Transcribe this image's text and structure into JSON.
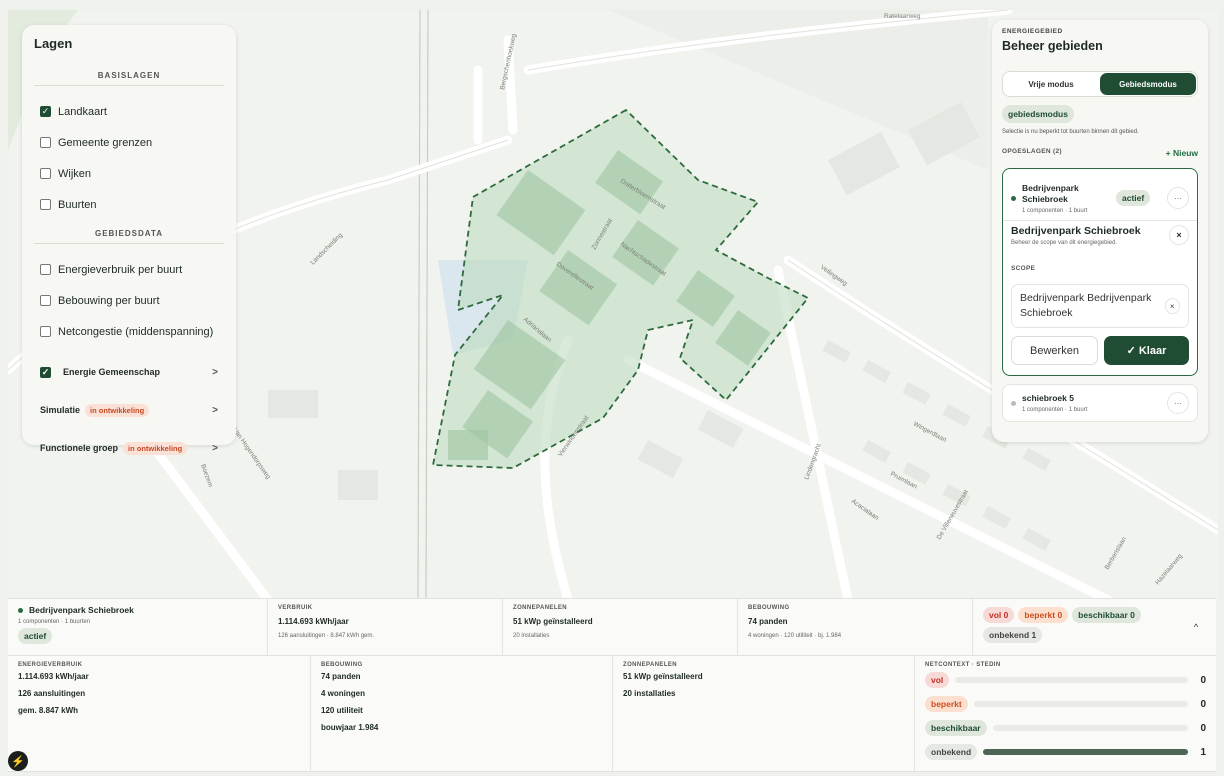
{
  "map": {
    "street_labels": [
      "Ratelaarweg",
      "Bergschenhoekweg",
      "Landscheiding",
      "Dotterbloemstraat",
      "Zonnestraat",
      "Nachtschadestraat",
      "Doverellestraat",
      "Adrianalaan",
      "Veilingweg",
      "Vierwindenstraat",
      "Wingerdlaan",
      "Pruimlaan",
      "Acacialaan",
      "De Villeneuvestraat",
      "Lindengracht",
      "Berberislaan",
      "Hazelaarweg",
      "Van Hogendorpsweg",
      "Boezem"
    ]
  },
  "layers": {
    "title": "Lagen",
    "basis_heading": "BASISLAGEN",
    "basis": [
      {
        "label": "Landkaart",
        "checked": true
      },
      {
        "label": "Gemeente grenzen",
        "checked": false
      },
      {
        "label": "Wijken",
        "checked": false
      },
      {
        "label": "Buurten",
        "checked": false
      }
    ],
    "gebied_heading": "GEBIEDSDATA",
    "gebied": [
      {
        "label": "Energieverbruik per buurt",
        "checked": false
      },
      {
        "label": "Bebouwing per buurt",
        "checked": false
      },
      {
        "label": "Netcongestie (middenspanning)",
        "checked": false
      }
    ],
    "features": [
      {
        "label": "Energie Gemeenschap",
        "checked": true,
        "tag": ""
      },
      {
        "label": "Simulatie",
        "tag": "in ontwikkeling"
      },
      {
        "label": "Functionele groep",
        "tag": "in ontwikkeling"
      }
    ],
    "chevron": ">"
  },
  "energy": {
    "eyebrow": "ENERGIEGEBIED",
    "title": "Beheer gebieden",
    "mode_free": "Vrije modus",
    "mode_area": "Gebiedsmodus",
    "mode_pill": "gebiedsmodus",
    "hint": "Selectie is nu beperkt tot buurten binnen dit gebied.",
    "saved_label": "OPGESLAGEN (2)",
    "new_label": "+ Nieuw",
    "areas": [
      {
        "name": "Bedrijvenpark Schiebroek",
        "meta": "1 componenten · 1 buurt",
        "badge": "actief"
      },
      {
        "name": "schiebroek 5",
        "meta": "1 componenten · 1 buurt"
      }
    ],
    "detail_title": "Bedrijvenpark Schiebroek",
    "detail_sub": "Beheer de scope van dit energiegebied.",
    "scope_label": "SCOPE",
    "scope_value": "Bedrijvenpark Bedrijvenpark Schiebroek",
    "edit_label": "Bewerken",
    "done_label": "✓ Klaar",
    "more": "···",
    "close": "×"
  },
  "summary": {
    "name": "Bedrijvenpark Schiebroek",
    "meta": "1 componenten · 1 buurten",
    "badge": "actief",
    "verbruik_label": "VERBRUIK",
    "verbruik_value": "1.114.693 kWh/jaar",
    "verbruik_sub": "126 aansluitingen · 8.847 kWh gem.",
    "zonne_label": "ZONNEPANELEN",
    "zonne_value": "51 kWp geïnstalleerd",
    "zonne_sub": "20 installaties",
    "bebouwing_label": "BEBOUWING",
    "bebouwing_value": "74 panden",
    "bebouwing_sub": "4 woningen · 120 utiliteit · bj. 1.984",
    "status": {
      "vol": "vol 0",
      "beperkt": "beperkt 0",
      "beschikbaar": "beschikbaar 0",
      "onbekend": "onbekend 1"
    },
    "collapse": "^"
  },
  "details": {
    "energie_label": "ENERGIEVERBRUIK",
    "energie_lines": [
      "1.114.693 kWh/jaar",
      "126 aansluitingen",
      "gem. 8.847 kWh"
    ],
    "bebouwing_label": "BEBOUWING",
    "bebouwing_lines": [
      "74 panden",
      "4 woningen",
      "120 utiliteit",
      "bouwjaar 1.984"
    ],
    "zonne_label": "ZONNEPANELEN",
    "zonne_lines": [
      "51 kWp geïnstalleerd",
      "20 installaties"
    ],
    "net_label": "NETCONTEXT · STEDIN",
    "net_rows": [
      {
        "label": "vol",
        "value": "0",
        "fraction": 0
      },
      {
        "label": "beperkt",
        "value": "0",
        "fraction": 0
      },
      {
        "label": "beschikbaar",
        "value": "0",
        "fraction": 0
      },
      {
        "label": "onbekend",
        "value": "1",
        "fraction": 1
      }
    ]
  },
  "colors": {
    "accent": "#1f4c33",
    "area_fill": "#b9d9bb",
    "area_stroke": "#2d6b3c"
  },
  "icons": {
    "bolt": "⚡"
  }
}
